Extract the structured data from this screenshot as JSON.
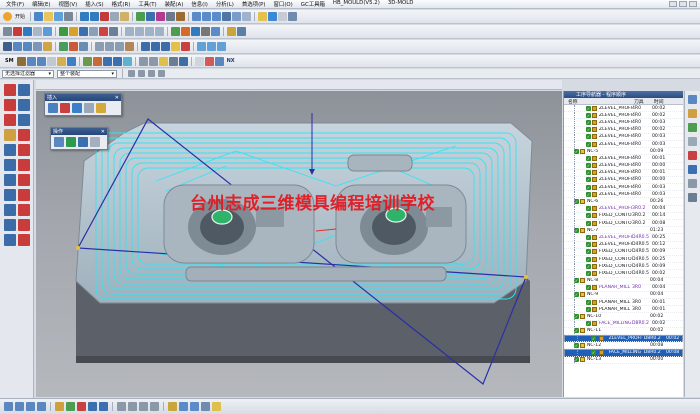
{
  "menu": {
    "items": [
      "文件(F)",
      "编辑(E)",
      "视图(V)",
      "插入(S)",
      "格式(R)",
      "工具(T)",
      "装配(A)",
      "信息(I)",
      "分析(L)",
      "首选项(P)",
      "窗口(O)",
      "GC工具箱",
      "HB_MOULD(V5.2)",
      "3D-MOLD"
    ]
  },
  "toolbar": {
    "start_label": "开始",
    "nx_badge": "NX"
  },
  "filter": {
    "select_all": "无选择过滤器",
    "scope": "整个装配"
  },
  "insert_toolbar": {
    "title": "插入"
  },
  "operate_toolbar": {
    "title": "操作"
  },
  "watermark": "台州志成三维模具编程培训学校",
  "nav": {
    "title": "工序导航器 - 程序顺序",
    "col_name": "名称",
    "col_tool": "刀具",
    "col_time": "时间",
    "rows": [
      {
        "kind": "op",
        "name": "ZLEVEL_PROFI",
        "tool": "4R0",
        "time": "00:02"
      },
      {
        "kind": "op",
        "name": "ZLEVEL_PROFI",
        "tool": "4R0",
        "time": "00:02"
      },
      {
        "kind": "op",
        "name": "ZLEVEL_PROFI",
        "tool": "4R0",
        "time": "00:03"
      },
      {
        "kind": "op",
        "name": "ZLEVEL_PROFI",
        "tool": "4R0",
        "time": "00:02"
      },
      {
        "kind": "op",
        "name": "ZLEVEL_PROFI",
        "tool": "4R0",
        "time": "00:03"
      },
      {
        "kind": "op",
        "name": "ZLEVEL_PROFI",
        "tool": "4R0",
        "time": "00:03"
      },
      {
        "kind": "grp",
        "name": "NC-5",
        "tool": "",
        "time": "00:09"
      },
      {
        "kind": "op",
        "name": "ZLEVEL_PROFI",
        "tool": "4R0",
        "time": "00:01"
      },
      {
        "kind": "op",
        "name": "ZLEVEL_PROFI",
        "tool": "4R0",
        "time": "00:00"
      },
      {
        "kind": "op",
        "name": "ZLEVEL_PROFI",
        "tool": "4R0",
        "time": "00:01"
      },
      {
        "kind": "op",
        "name": "ZLEVEL_PROFI",
        "tool": "4R0",
        "time": "00:00"
      },
      {
        "kind": "op",
        "name": "ZLEVEL_PROFI",
        "tool": "4R0",
        "time": "00:03"
      },
      {
        "kind": "op",
        "name": "ZLEVEL_PROFI",
        "tool": "4R0",
        "time": "00:03"
      },
      {
        "kind": "grp",
        "name": "NC-6",
        "tool": "",
        "time": "00:26"
      },
      {
        "kind": "op",
        "name": "ZLEVEL_PROFI",
        "tool": "3R0.2",
        "time": "00:04",
        "purple": true
      },
      {
        "kind": "op",
        "name": "FIXED_CONTO",
        "tool": "3R0.2",
        "time": "00:14"
      },
      {
        "kind": "op",
        "name": "FIXED_CONTO",
        "tool": "3R0.2",
        "time": "00:08"
      },
      {
        "kind": "grp",
        "name": "NC-7",
        "tool": "",
        "time": "01:23"
      },
      {
        "kind": "op",
        "name": "ZLEVEL_PROFI",
        "tool": "D4R0.5",
        "time": "00:25",
        "purple": true
      },
      {
        "kind": "op",
        "name": "ZLEVEL_PROFI",
        "tool": "D4R0.5",
        "time": "00:12"
      },
      {
        "kind": "op",
        "name": "FIXED_CONTO",
        "tool": "D4R0.5",
        "time": "00:09"
      },
      {
        "kind": "op",
        "name": "FIXED_CONTO",
        "tool": "D4R0.5",
        "time": "00:25"
      },
      {
        "kind": "op",
        "name": "FIXED_CONTO",
        "tool": "D4R0.5",
        "time": "00:09"
      },
      {
        "kind": "op",
        "name": "FIXED_CONTO",
        "tool": "D4R0.5",
        "time": "00:02"
      },
      {
        "kind": "grp",
        "name": "NC-8",
        "tool": "",
        "time": "00:04"
      },
      {
        "kind": "op",
        "name": "PLANAR_MILL",
        "tool": "3R0",
        "time": "00:04",
        "purple": true
      },
      {
        "kind": "grp",
        "name": "NC-9",
        "tool": "",
        "time": "00:04"
      },
      {
        "kind": "op",
        "name": "PLANAR_MILL",
        "tool": "3R0",
        "time": "00:01"
      },
      {
        "kind": "op",
        "name": "PLANAR_MILL",
        "tool": "3R0",
        "time": "00:01"
      },
      {
        "kind": "grp",
        "name": "NC-10",
        "tool": "",
        "time": "00:02"
      },
      {
        "kind": "op",
        "name": "FACE_MILLING",
        "tool": "D8R0.2",
        "time": "00:02",
        "purple": true
      },
      {
        "kind": "grp",
        "name": "NC-11",
        "tool": "",
        "time": "00:02"
      },
      {
        "kind": "op",
        "name": "ZLEVEL_PROFI",
        "tool": "D8R0.2",
        "time": "00:02",
        "selected": true
      },
      {
        "kind": "grp",
        "name": "NC-12",
        "tool": "",
        "time": "00:08"
      },
      {
        "kind": "op",
        "name": "FACE_MILLING",
        "tool": "D8R0.2",
        "time": "00:08",
        "selected": true
      },
      {
        "kind": "grp",
        "name": "NC-13",
        "tool": "",
        "time": "00:00"
      }
    ]
  },
  "colors": {
    "toolpath": "#30e6f2",
    "accent": "#2c4d82",
    "watermark": "#e4161e"
  }
}
